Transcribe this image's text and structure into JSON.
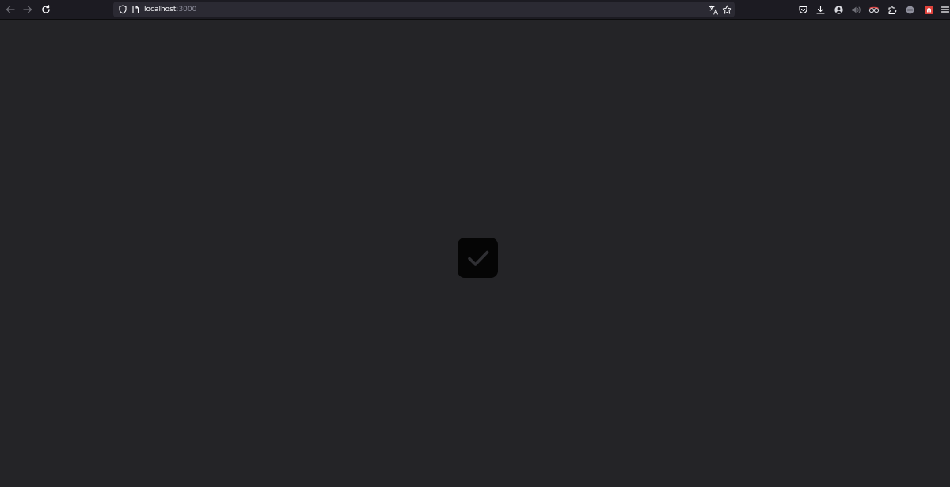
{
  "browser": {
    "url_host": "localhost",
    "url_port": ":3000"
  },
  "icons": {
    "back": "back-arrow-icon",
    "forward": "forward-arrow-icon",
    "reload": "reload-icon",
    "shield": "tracking-protection-shield-icon",
    "page": "page-info-icon",
    "translate": "translate-icon",
    "bookmark": "bookmark-star-icon",
    "pocket": "pocket-icon",
    "downloads": "downloads-icon",
    "account": "account-icon",
    "sound": "sound-icon",
    "glasses": "extension-glasses-icon",
    "extensions": "extensions-puzzle-icon",
    "blocker": "extension-blocker-icon",
    "red_extension": "extension-red-icon",
    "menu": "hamburger-menu-icon"
  },
  "page": {
    "checkbox_checked": true
  },
  "colors": {
    "page_background": "#242427",
    "toolbar_background": "#1c1b22",
    "checkbox_background": "#050505",
    "checkmark": "#2f2f33"
  }
}
